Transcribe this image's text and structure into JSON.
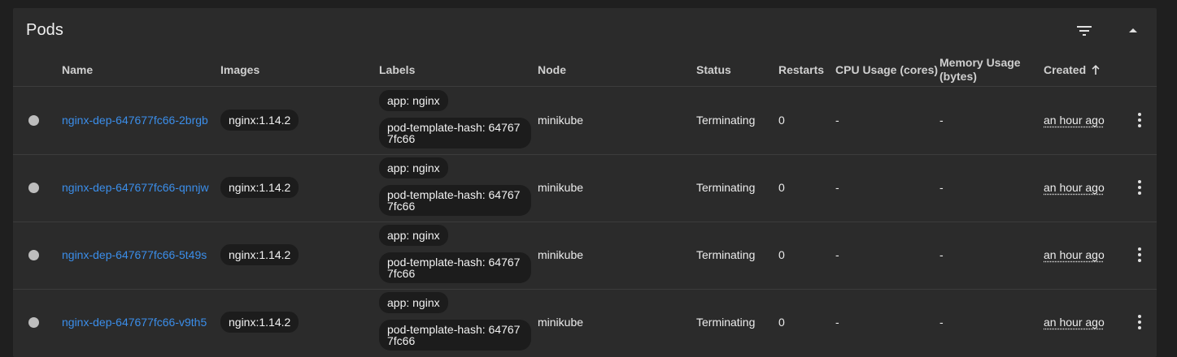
{
  "card": {
    "title": "Pods",
    "icons": {
      "filter": "filter-icon",
      "collapse": "expand-less-icon"
    }
  },
  "columns": {
    "name": "Name",
    "images": "Images",
    "labels": "Labels",
    "node": "Node",
    "status": "Status",
    "restarts": "Restarts",
    "cpu": "CPU Usage (cores)",
    "memory_line1": "Memory Usage",
    "memory_line2": "(bytes)",
    "created": "Created"
  },
  "rows": [
    {
      "name": "nginx-dep-647677fc66-2brgb",
      "image": "nginx:1.14.2",
      "label1": "app: nginx",
      "label2": "pod-template-hash: 647677fc66",
      "node": "minikube",
      "status": "Terminating",
      "restarts": "0",
      "cpu": "-",
      "memory": "-",
      "created": "an hour ago"
    },
    {
      "name": "nginx-dep-647677fc66-qnnjw",
      "image": "nginx:1.14.2",
      "label1": "app: nginx",
      "label2": "pod-template-hash: 647677fc66",
      "node": "minikube",
      "status": "Terminating",
      "restarts": "0",
      "cpu": "-",
      "memory": "-",
      "created": "an hour ago"
    },
    {
      "name": "nginx-dep-647677fc66-5t49s",
      "image": "nginx:1.14.2",
      "label1": "app: nginx",
      "label2": "pod-template-hash: 647677fc66",
      "node": "minikube",
      "status": "Terminating",
      "restarts": "0",
      "cpu": "-",
      "memory": "-",
      "created": "an hour ago"
    },
    {
      "name": "nginx-dep-647677fc66-v9th5",
      "image": "nginx:1.14.2",
      "label1": "app: nginx",
      "label2": "pod-template-hash: 647677fc66",
      "node": "minikube",
      "status": "Terminating",
      "restarts": "0",
      "cpu": "-",
      "memory": "-",
      "created": "an hour ago"
    }
  ],
  "colors": {
    "link": "#3b8eea",
    "status_dot": "#bdbdbd",
    "card_bg": "#2b2b2b",
    "page_bg": "#1f1f1f"
  }
}
